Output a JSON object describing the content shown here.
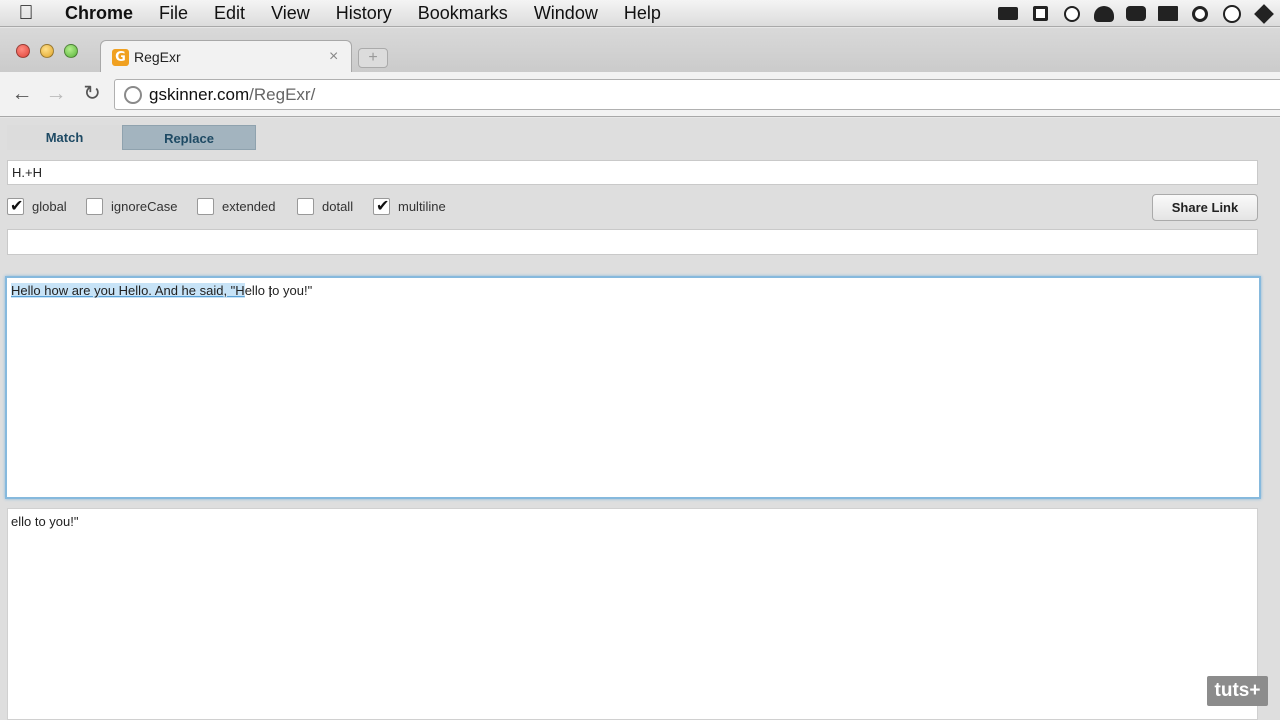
{
  "menubar": {
    "app": "Chrome",
    "items": [
      "File",
      "Edit",
      "View",
      "History",
      "Bookmarks",
      "Window",
      "Help"
    ],
    "status_icons": [
      "camera-icon",
      "copy-icon",
      "circle-icon",
      "alien-icon",
      "chat-icon",
      "display-icon",
      "sync-icon",
      "time-machine-icon",
      "move-icon"
    ]
  },
  "tab": {
    "title": "RegExr",
    "favicon_letter": "G",
    "close": "×",
    "new_tab": "+"
  },
  "toolbar": {
    "back": "←",
    "forward": "→",
    "reload": "↻",
    "url_host": "gskinner.com",
    "url_path": "/RegExr/"
  },
  "regexr": {
    "tabs": {
      "match": "Match",
      "replace": "Replace"
    },
    "pattern": "H.+H",
    "flags": [
      {
        "label": "global",
        "checked": true
      },
      {
        "label": "ignoreCase",
        "checked": false
      },
      {
        "label": "extended",
        "checked": false
      },
      {
        "label": "dotall",
        "checked": false
      },
      {
        "label": "multiline",
        "checked": true
      }
    ],
    "share_link": "Share Link",
    "replace_value": "",
    "source": {
      "matched": "Hello how are you Hello. And he said, \"H",
      "rest": "ello to you!\""
    },
    "result": "ello to you!\""
  },
  "watermark": "tuts+"
}
